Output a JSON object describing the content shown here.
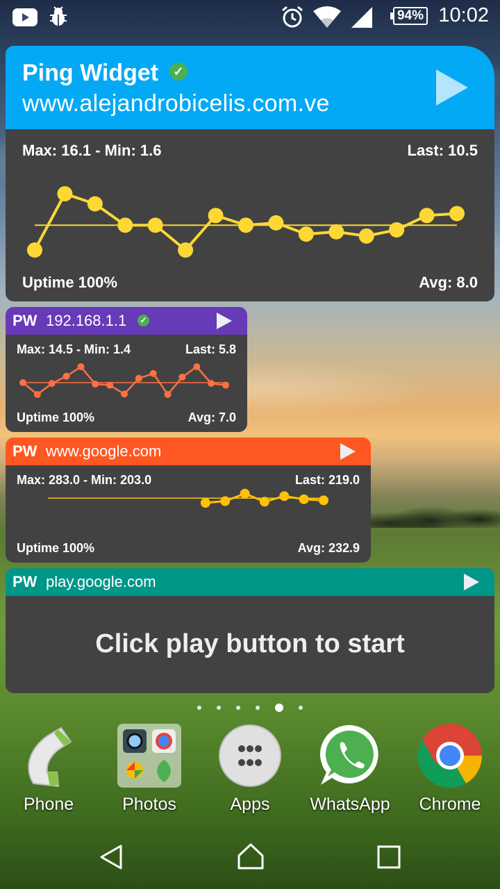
{
  "status_bar": {
    "time": "10:02",
    "battery": "94%",
    "icons": [
      "youtube-icon",
      "bug-icon",
      "alarm-icon",
      "wifi-icon",
      "signal-icon",
      "battery-icon"
    ]
  },
  "widgets": {
    "main": {
      "title": "Ping Widget",
      "host": "www.alejandrobicelis.com.ve",
      "max_min": "Max: 16.1 - Min: 1.6",
      "last": "Last: 10.5",
      "uptime": "Uptime 100%",
      "avg": "Avg: 8.0",
      "header_color": "#03a9f4",
      "line_color": "#fdd835",
      "chart_data": {
        "type": "line",
        "ylim": [
          1.6,
          16.1
        ],
        "average": 8.0,
        "values": [
          1.6,
          16.1,
          13.5,
          8.0,
          8.0,
          1.6,
          10.5,
          8.0,
          8.6,
          5.7,
          6.3,
          5.2,
          6.8,
          10.5,
          11.0
        ]
      }
    },
    "lan": {
      "label": "PW",
      "host": "192.168.1.1",
      "max_min": "Max: 14.5 - Min: 1.4",
      "last": "Last: 5.8",
      "uptime": "Uptime 100%",
      "avg": "Avg: 7.0",
      "header_color": "#673ab7",
      "line_color": "#ff7043",
      "chart_data": {
        "type": "line",
        "ylim": [
          1.4,
          14.5
        ],
        "average": 7.0,
        "values": [
          7.0,
          1.4,
          6.6,
          10.0,
          14.5,
          6.3,
          5.8,
          1.6,
          9.0,
          11.3,
          1.4,
          9.6,
          14.5,
          6.6,
          5.8
        ]
      }
    },
    "google": {
      "label": "PW",
      "host": "www.google.com",
      "max_min": "Max: 283.0 - Min: 203.0",
      "last": "Last: 219.0",
      "uptime": "Uptime 100%",
      "avg": "Avg: 232.9",
      "header_color": "#ff5722",
      "line_color": "#ffc107",
      "chart_data": {
        "type": "line",
        "ylim": [
          203.0,
          283.0
        ],
        "average": 232.9,
        "x_start": 8,
        "x_count": 15,
        "values": [
          203.0,
          214.0,
          262.0,
          210.0,
          246.0,
          226.0,
          219.0
        ]
      }
    },
    "play": {
      "label": "PW",
      "host": "play.google.com",
      "message": "Click play button to start",
      "header_color": "#009688"
    }
  },
  "page_indicator": {
    "count": 6,
    "active": 4
  },
  "dock": [
    {
      "label": "Phone",
      "icon": "phone-icon"
    },
    {
      "label": "Photos",
      "icon": "photos-folder-icon"
    },
    {
      "label": "Apps",
      "icon": "apps-icon"
    },
    {
      "label": "WhatsApp",
      "icon": "whatsapp-icon"
    },
    {
      "label": "Chrome",
      "icon": "chrome-icon"
    }
  ],
  "nav_bar": [
    "back-icon",
    "home-icon",
    "recents-icon"
  ]
}
